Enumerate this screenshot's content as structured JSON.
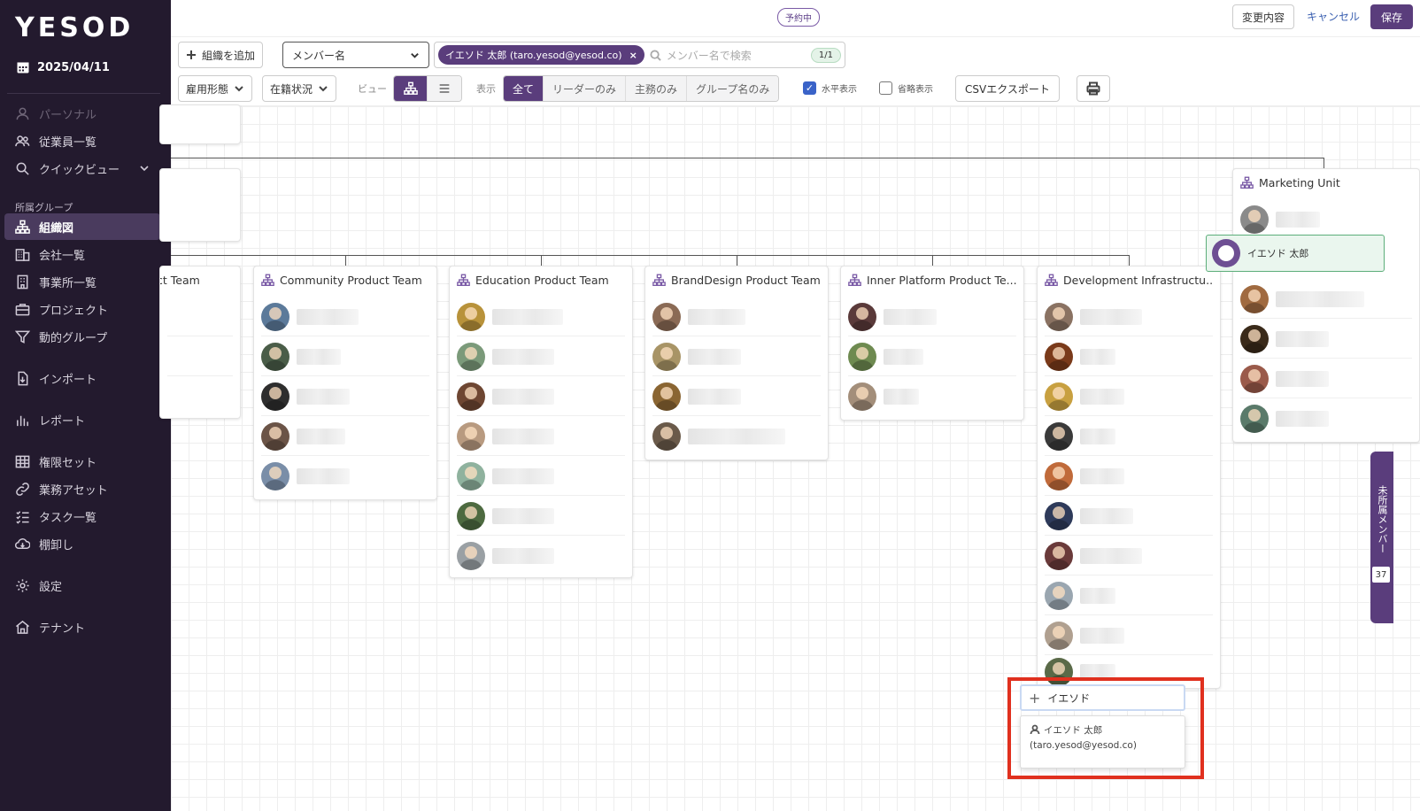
{
  "app": {
    "logo": "YESOD",
    "date": "2025/04/11"
  },
  "sidebar": {
    "section_label": "所属グループ",
    "items": [
      {
        "label": "パーソナル",
        "icon": "person-icon",
        "disabled": true
      },
      {
        "label": "従業員一覧",
        "icon": "people-icon"
      },
      {
        "label": "クイックビュー",
        "icon": "search-icon"
      },
      {
        "label": "組織図",
        "icon": "org-chart-icon",
        "active": true
      },
      {
        "label": "会社一覧",
        "icon": "building-icon"
      },
      {
        "label": "事業所一覧",
        "icon": "office-icon"
      },
      {
        "label": "プロジェクト",
        "icon": "briefcase-icon"
      },
      {
        "label": "動的グループ",
        "icon": "filter-icon"
      },
      {
        "label": "インポート",
        "icon": "import-icon"
      },
      {
        "label": "レポート",
        "icon": "chart-icon"
      },
      {
        "label": "権限セット",
        "icon": "grid-icon"
      },
      {
        "label": "業務アセット",
        "icon": "link-icon"
      },
      {
        "label": "タスク一覧",
        "icon": "checklist-icon"
      },
      {
        "label": "棚卸し",
        "icon": "cloud-icon"
      },
      {
        "label": "設定",
        "icon": "gear-icon"
      },
      {
        "label": "テナント",
        "icon": "tenant-icon"
      }
    ]
  },
  "header": {
    "status_badge": "予約中",
    "changes_label": "変更内容",
    "cancel_label": "キャンセル",
    "save_label": "保存"
  },
  "toolbar": {
    "add_org_label": "組織を追加",
    "member_select": "メンバー名",
    "chip_label": "イエソド 太郎 (taro.yesod@yesod.co)",
    "chip_remove": "×",
    "search_placeholder": "メンバー名で検索",
    "match_count": "1/1",
    "employment_filter": "雇用形態",
    "status_filter": "在籍状況",
    "view_label": "ビュー",
    "display_label": "表示",
    "display_options": [
      "全て",
      "リーダーのみ",
      "主務のみ",
      "グループ名のみ"
    ],
    "horizontal_label": "水平表示",
    "compact_label": "省略表示",
    "csv_label": "CSVエクスポート"
  },
  "chart": {
    "teams": [
      {
        "name": "ct Team",
        "members": 3
      },
      {
        "name": "Community Product Team",
        "members": 5
      },
      {
        "name": "Education Product Team",
        "members": 7
      },
      {
        "name": "BrandDesign Product Team",
        "members": 4
      },
      {
        "name": "Inner Platform Product Te...",
        "members": 3
      },
      {
        "name": "Development Infrastructu...",
        "members": 10
      },
      {
        "name": "Marketing Unit",
        "members": 5
      }
    ],
    "highlighted_member": "イエソド 太郎"
  },
  "drawer": {
    "label": "未所属メンバー",
    "count": "37"
  },
  "add_member": {
    "input_value": "イエソド",
    "result_name": "イエソド 太郎",
    "result_email": "(taro.yesod@yesod.co)"
  },
  "colors": {
    "sidebar_bg": "#231a2e",
    "accent": "#5a3d7c",
    "highlight_border": "#e0301e"
  }
}
